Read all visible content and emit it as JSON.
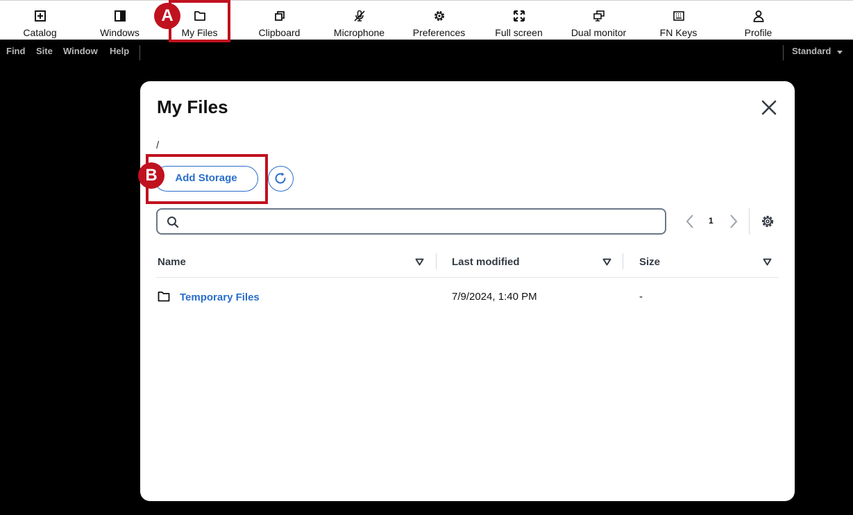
{
  "toolbar": {
    "items": [
      {
        "label": "Catalog",
        "icon": "plus-square-icon"
      },
      {
        "label": "Windows",
        "icon": "window-icon"
      },
      {
        "label": "My Files",
        "icon": "folder-icon"
      },
      {
        "label": "Clipboard",
        "icon": "clipboard-icon"
      },
      {
        "label": "Microphone",
        "icon": "microphone-muted-icon"
      },
      {
        "label": "Preferences",
        "icon": "gear-icon"
      },
      {
        "label": "Full screen",
        "icon": "fullscreen-icon"
      },
      {
        "label": "Dual monitor",
        "icon": "dual-monitor-icon"
      },
      {
        "label": "FN Keys",
        "icon": "keyboard-icon"
      },
      {
        "label": "Profile",
        "icon": "person-icon"
      }
    ]
  },
  "menubar": {
    "items": [
      "Find",
      "Site",
      "Window",
      "Help"
    ],
    "mode": "Standard"
  },
  "annotations": {
    "a": "A",
    "b": "B",
    "color": "#c0111f"
  },
  "modal": {
    "title": "My Files",
    "path": "/",
    "add_storage_label": "Add Storage",
    "search_placeholder": "",
    "page": "1",
    "columns": [
      "Name",
      "Last modified",
      "Size"
    ],
    "rows": [
      {
        "name": "Temporary Files",
        "type": "folder",
        "last_modified": "7/9/2024, 1:40 PM",
        "size": "-"
      }
    ]
  },
  "colors": {
    "accent": "#2a6ecb",
    "annotation": "#c0111f"
  }
}
